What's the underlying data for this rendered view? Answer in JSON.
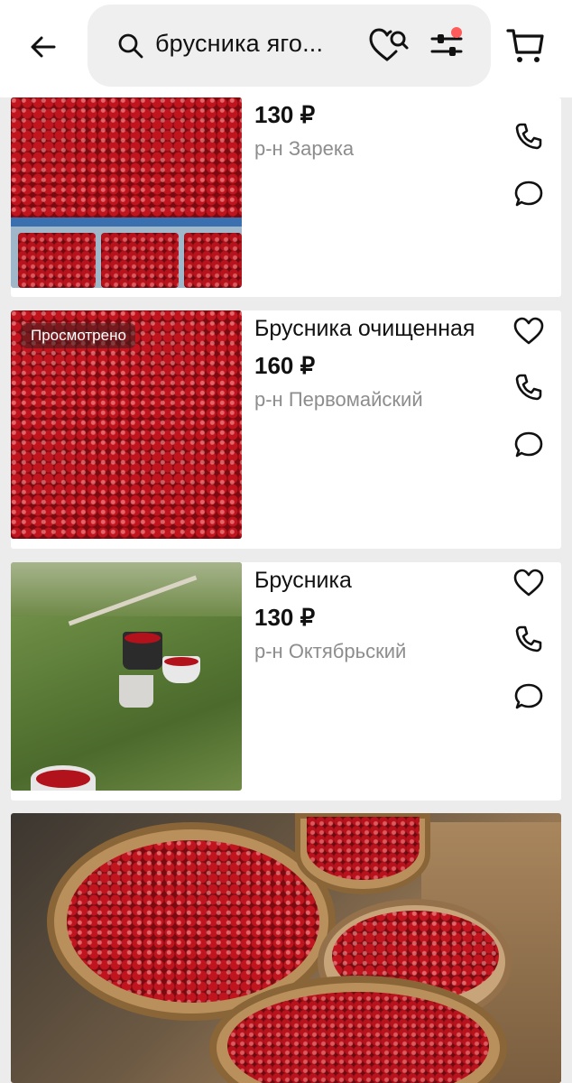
{
  "search": {
    "query": "брусника яго..."
  },
  "icons": {
    "back": "arrow-left-icon",
    "search": "search-icon",
    "saved_search": "heart-search-icon",
    "filters": "sliders-icon",
    "cart": "cart-icon"
  },
  "colors": {
    "accent_dot": "#ff5b5b",
    "muted_text": "#8d8d8d"
  },
  "listings": [
    {
      "title": "",
      "price": "130 ₽",
      "location": "р-н Зарека"
    },
    {
      "badge": "Просмотрено",
      "title": "Брусника очищенная",
      "price": "160 ₽",
      "location": "р-н Первомайский"
    },
    {
      "title": "Брусника",
      "price": "130 ₽",
      "location": "р-н Октябрьский"
    }
  ]
}
